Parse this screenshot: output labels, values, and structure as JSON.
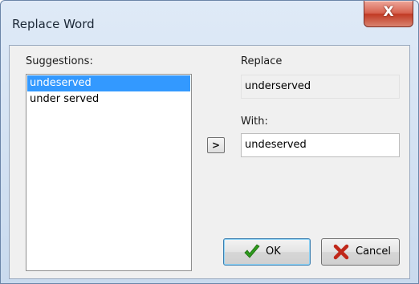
{
  "window": {
    "title": "Replace Word",
    "close_label": "X"
  },
  "suggestions": {
    "label": "Suggestions:",
    "items": [
      "undeserved",
      "under served"
    ],
    "selected_index": 0
  },
  "replace": {
    "label": "Replace",
    "value": "underserved"
  },
  "with": {
    "label": "With:",
    "value": "undeserved"
  },
  "arrow_button": {
    "label": ">"
  },
  "buttons": {
    "ok_label": "OK",
    "cancel_label": "Cancel"
  },
  "icons": {
    "ok": "check-icon",
    "cancel": "x-icon",
    "ok_color": "#2e9a1d",
    "cancel_color": "#c0281a"
  }
}
